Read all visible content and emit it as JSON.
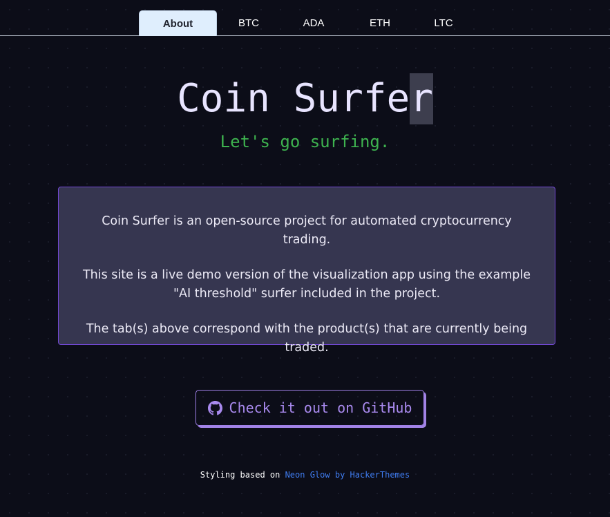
{
  "nav": {
    "tabs": [
      {
        "label": "About",
        "active": true
      },
      {
        "label": "BTC",
        "active": false
      },
      {
        "label": "ADA",
        "active": false
      },
      {
        "label": "ETH",
        "active": false
      },
      {
        "label": "LTC",
        "active": false
      }
    ]
  },
  "hero": {
    "title_main": "Coin Surfe",
    "title_cursor": "r",
    "subtitle": "Let's go surfing."
  },
  "card": {
    "paragraph1": "Coin Surfer is an open-source project for automated cryptocurrency trading.",
    "paragraph2": "This site is a live demo version of the visualization app using the example \"AI threshold\" surfer included in the project.",
    "paragraph3": "The tab(s) above correspond with the product(s) that are currently being traded."
  },
  "github_button": {
    "label": "Check it out on GitHub",
    "icon": "github-icon"
  },
  "footer": {
    "prefix": "Styling based on",
    "link1": "Neon Glow",
    "by": "by",
    "link2": "HackerThemes"
  },
  "colors": {
    "background": "#0c0d18",
    "accent_purple": "#a98aef",
    "subtitle_green": "#3eb34f",
    "link_blue": "#3f7cf0",
    "card_bg": "#363650",
    "active_tab_bg": "#dfeefd"
  }
}
